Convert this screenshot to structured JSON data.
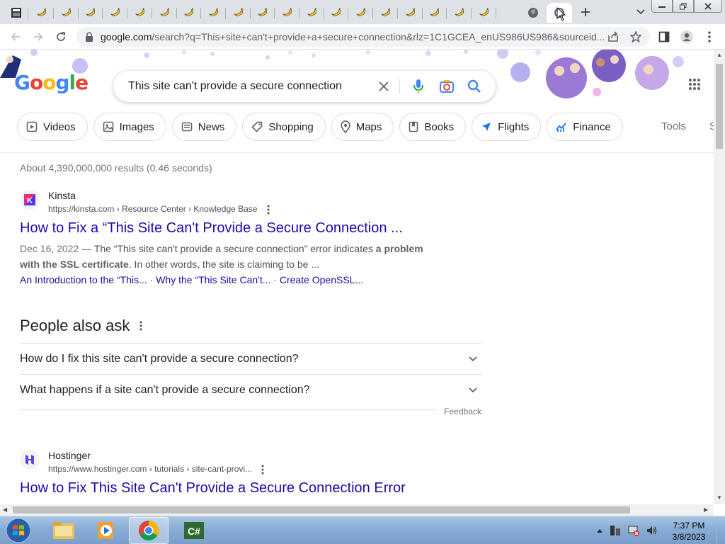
{
  "browser": {
    "tab_count_banana": 19,
    "url_host": "google.com",
    "url_rest": "/search?q=This+site+can't+provide+a+secure+connection&rlz=1C1GCEA_enUS986US986&sourceid..."
  },
  "google": {
    "logo_text": "Google",
    "search_query": "This site can't provide a secure connection",
    "chips": [
      {
        "label": "Videos",
        "icon": "video-icon"
      },
      {
        "label": "Images",
        "icon": "image-icon"
      },
      {
        "label": "News",
        "icon": "news-icon"
      },
      {
        "label": "Shopping",
        "icon": "tag-icon"
      },
      {
        "label": "Maps",
        "icon": "map-pin-icon"
      },
      {
        "label": "Books",
        "icon": "book-icon"
      },
      {
        "label": "Flights",
        "icon": "plane-icon"
      },
      {
        "label": "Finance",
        "icon": "finance-icon"
      }
    ],
    "tools_label": "Tools",
    "tools_overflow": "S",
    "result_stats": "About 4,390,000,000 results (0.46 seconds)",
    "results": [
      {
        "site_name": "Kinsta",
        "cite": "https://kinsta.com › Resource Center › Knowledge Base",
        "title": "How to Fix a “This Site Can't Provide a Secure Connection ...",
        "snippet_date": "Dec 16, 2022 — ",
        "snippet_plain1": "The “This site can't provide a secure connection” error indicates ",
        "snippet_bold": "a problem with the SSL certificate",
        "snippet_plain2": ". In other words, the site is claiming to be ...",
        "sublinks": [
          "An Introduction to the “This...",
          "Why the “This Site Can't...",
          "Create OpenSSL..."
        ]
      },
      {
        "site_name": "Hostinger",
        "cite": "https://www.hostinger.com › tutorials › site-cant-provi...",
        "title": "How to Fix This Site Can't Provide a Secure Connection Error"
      }
    ],
    "paa": {
      "title": "People also ask",
      "questions": [
        "How do I fix this site can't provide a secure connection?",
        "What happens if a site can't provide a secure connection?"
      ],
      "feedback": "Feedback"
    }
  },
  "taskbar": {
    "time": "7:37 PM",
    "date": "3/8/2023"
  },
  "colors": {
    "link": "#1a0dab",
    "tab_bar": "#dee1e6",
    "taskbar": "#89acd5"
  }
}
